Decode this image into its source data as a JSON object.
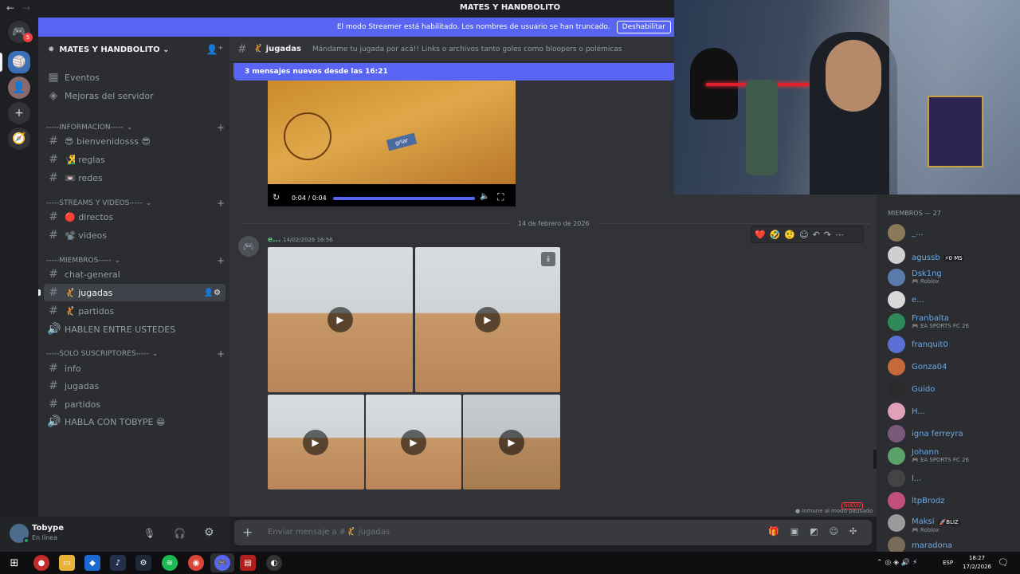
{
  "titlebar": {
    "back": "←",
    "forward": "→",
    "title": "MATES Y HANDBOLITO"
  },
  "rail": {
    "badge": "5"
  },
  "streamer": {
    "text": "El modo Streamer está habilitado. Los nombres de usuario se han truncado.",
    "button": "Deshabilitar"
  },
  "server": {
    "name": "MATES Y HANDBOLITO ⌄"
  },
  "sidebar": {
    "top_items": [
      "Eventos",
      "Mejoras del servidor"
    ],
    "cat_info": "-----INFORMACION-----",
    "ch_bienvenidos": "😎 bienvenidosss 😎",
    "ch_reglas": "🧏‍♂️ reglas",
    "ch_redes": "📼 redes",
    "cat_streams": "-----STREAMS Y VIDEOS-----",
    "ch_directos": "🔴 directos",
    "ch_videos": "📽️ videos",
    "cat_miembros": "-----MIEMBROS-----",
    "ch_general": "chat-general",
    "ch_jugadas": "🤾 jugadas",
    "ch_partidos": "🤾 partidos",
    "ch_hablen": "HABLEN ENTRE USTEDES",
    "cat_subs": "-----SOLO SUSCRIPTORES-----",
    "ch_info": "info",
    "ch_jugadas2": "jugadas",
    "ch_partidos2": "partidos",
    "ch_habla": "HABLA CON TOBYPE 😁"
  },
  "user": {
    "name": "Tobype",
    "status": "En línea"
  },
  "channel": {
    "name": "🤾 jugadas",
    "topic": "Mándame tu jugada por acá!! Links o archivos tanto goles como bloopers o polémicas"
  },
  "new_messages": "3 mensajes nuevos desde las 16:21",
  "video": {
    "time": "0:04 / 0:04",
    "progress": 1.0
  },
  "date_divider": "14 de febrero de 2026",
  "message": {
    "author": "e...",
    "timestamp": "14/02/2026 16:56"
  },
  "reactions": [
    "❤️",
    "🤣",
    "🤨"
  ],
  "paused_note": "Inmune al modo pausado",
  "nuevo_label": "NUEVO",
  "composer": {
    "placeholder": "Enviar mensaje a #🤾 jugadas"
  },
  "members": {
    "header": "MIEMBROS — 27",
    "list": [
      {
        "name": "_...",
        "sub": ""
      },
      {
        "name": "agussb",
        "sub": "",
        "tag": "⚡0 MS"
      },
      {
        "name": "Dsk1ng",
        "sub": "🎮 Roblox"
      },
      {
        "name": "e...",
        "sub": ""
      },
      {
        "name": "Franbalta",
        "sub": "🎮 EA SPORTS FC 26"
      },
      {
        "name": "franquit0",
        "sub": ""
      },
      {
        "name": "Gonza04",
        "sub": ""
      },
      {
        "name": "Guido",
        "sub": ""
      },
      {
        "name": "H...",
        "sub": ""
      },
      {
        "name": "igna ferreyra",
        "sub": ""
      },
      {
        "name": "Johann",
        "sub": "🎮 EA SPORTS FC 26"
      },
      {
        "name": "l...",
        "sub": ""
      },
      {
        "name": "ltpBrodz",
        "sub": ""
      },
      {
        "name": "Maksi",
        "sub": "🎮 Roblox",
        "tag": "🚀BLIZ"
      },
      {
        "name": "maradona",
        "sub": ""
      }
    ]
  },
  "taskbar": {
    "lang": "ESP",
    "time": "18:27",
    "date": "17/2/2026"
  }
}
